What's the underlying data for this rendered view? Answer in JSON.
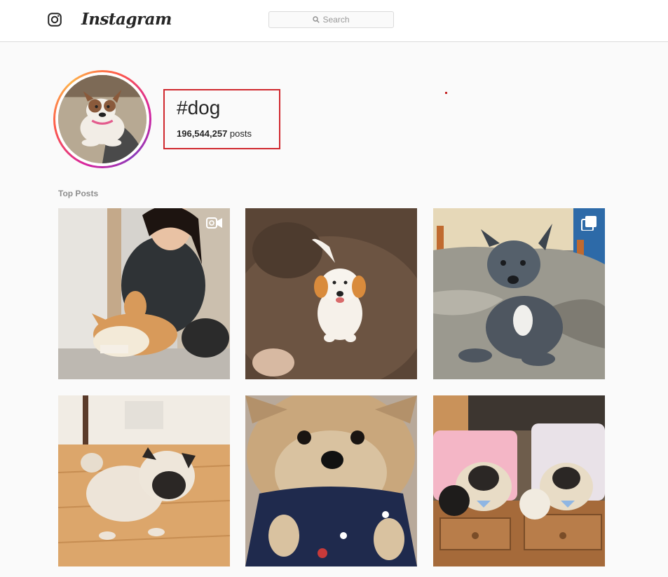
{
  "header": {
    "logo_text": "Instagram",
    "search_placeholder": "Search"
  },
  "hashtag": {
    "title": "#dog",
    "post_count": "196,544,257",
    "post_label": "posts"
  },
  "section": {
    "label": "Top Posts"
  },
  "posts": [
    {
      "subject": "woman-playing-with-corgi",
      "badge": "video-icon"
    },
    {
      "subject": "golden-puppy-running",
      "badge": ""
    },
    {
      "subject": "grey-pitbull-puppy-on-bed",
      "badge": "carousel-icon"
    },
    {
      "subject": "pug-puppy-on-floor",
      "badge": ""
    },
    {
      "subject": "yorkie-closeup",
      "badge": ""
    },
    {
      "subject": "pugs-with-unicorn-pillows",
      "badge": ""
    }
  ],
  "colors": {
    "highlight": "#d0282e",
    "border": "#dbdbdb",
    "background": "#fafafa"
  }
}
